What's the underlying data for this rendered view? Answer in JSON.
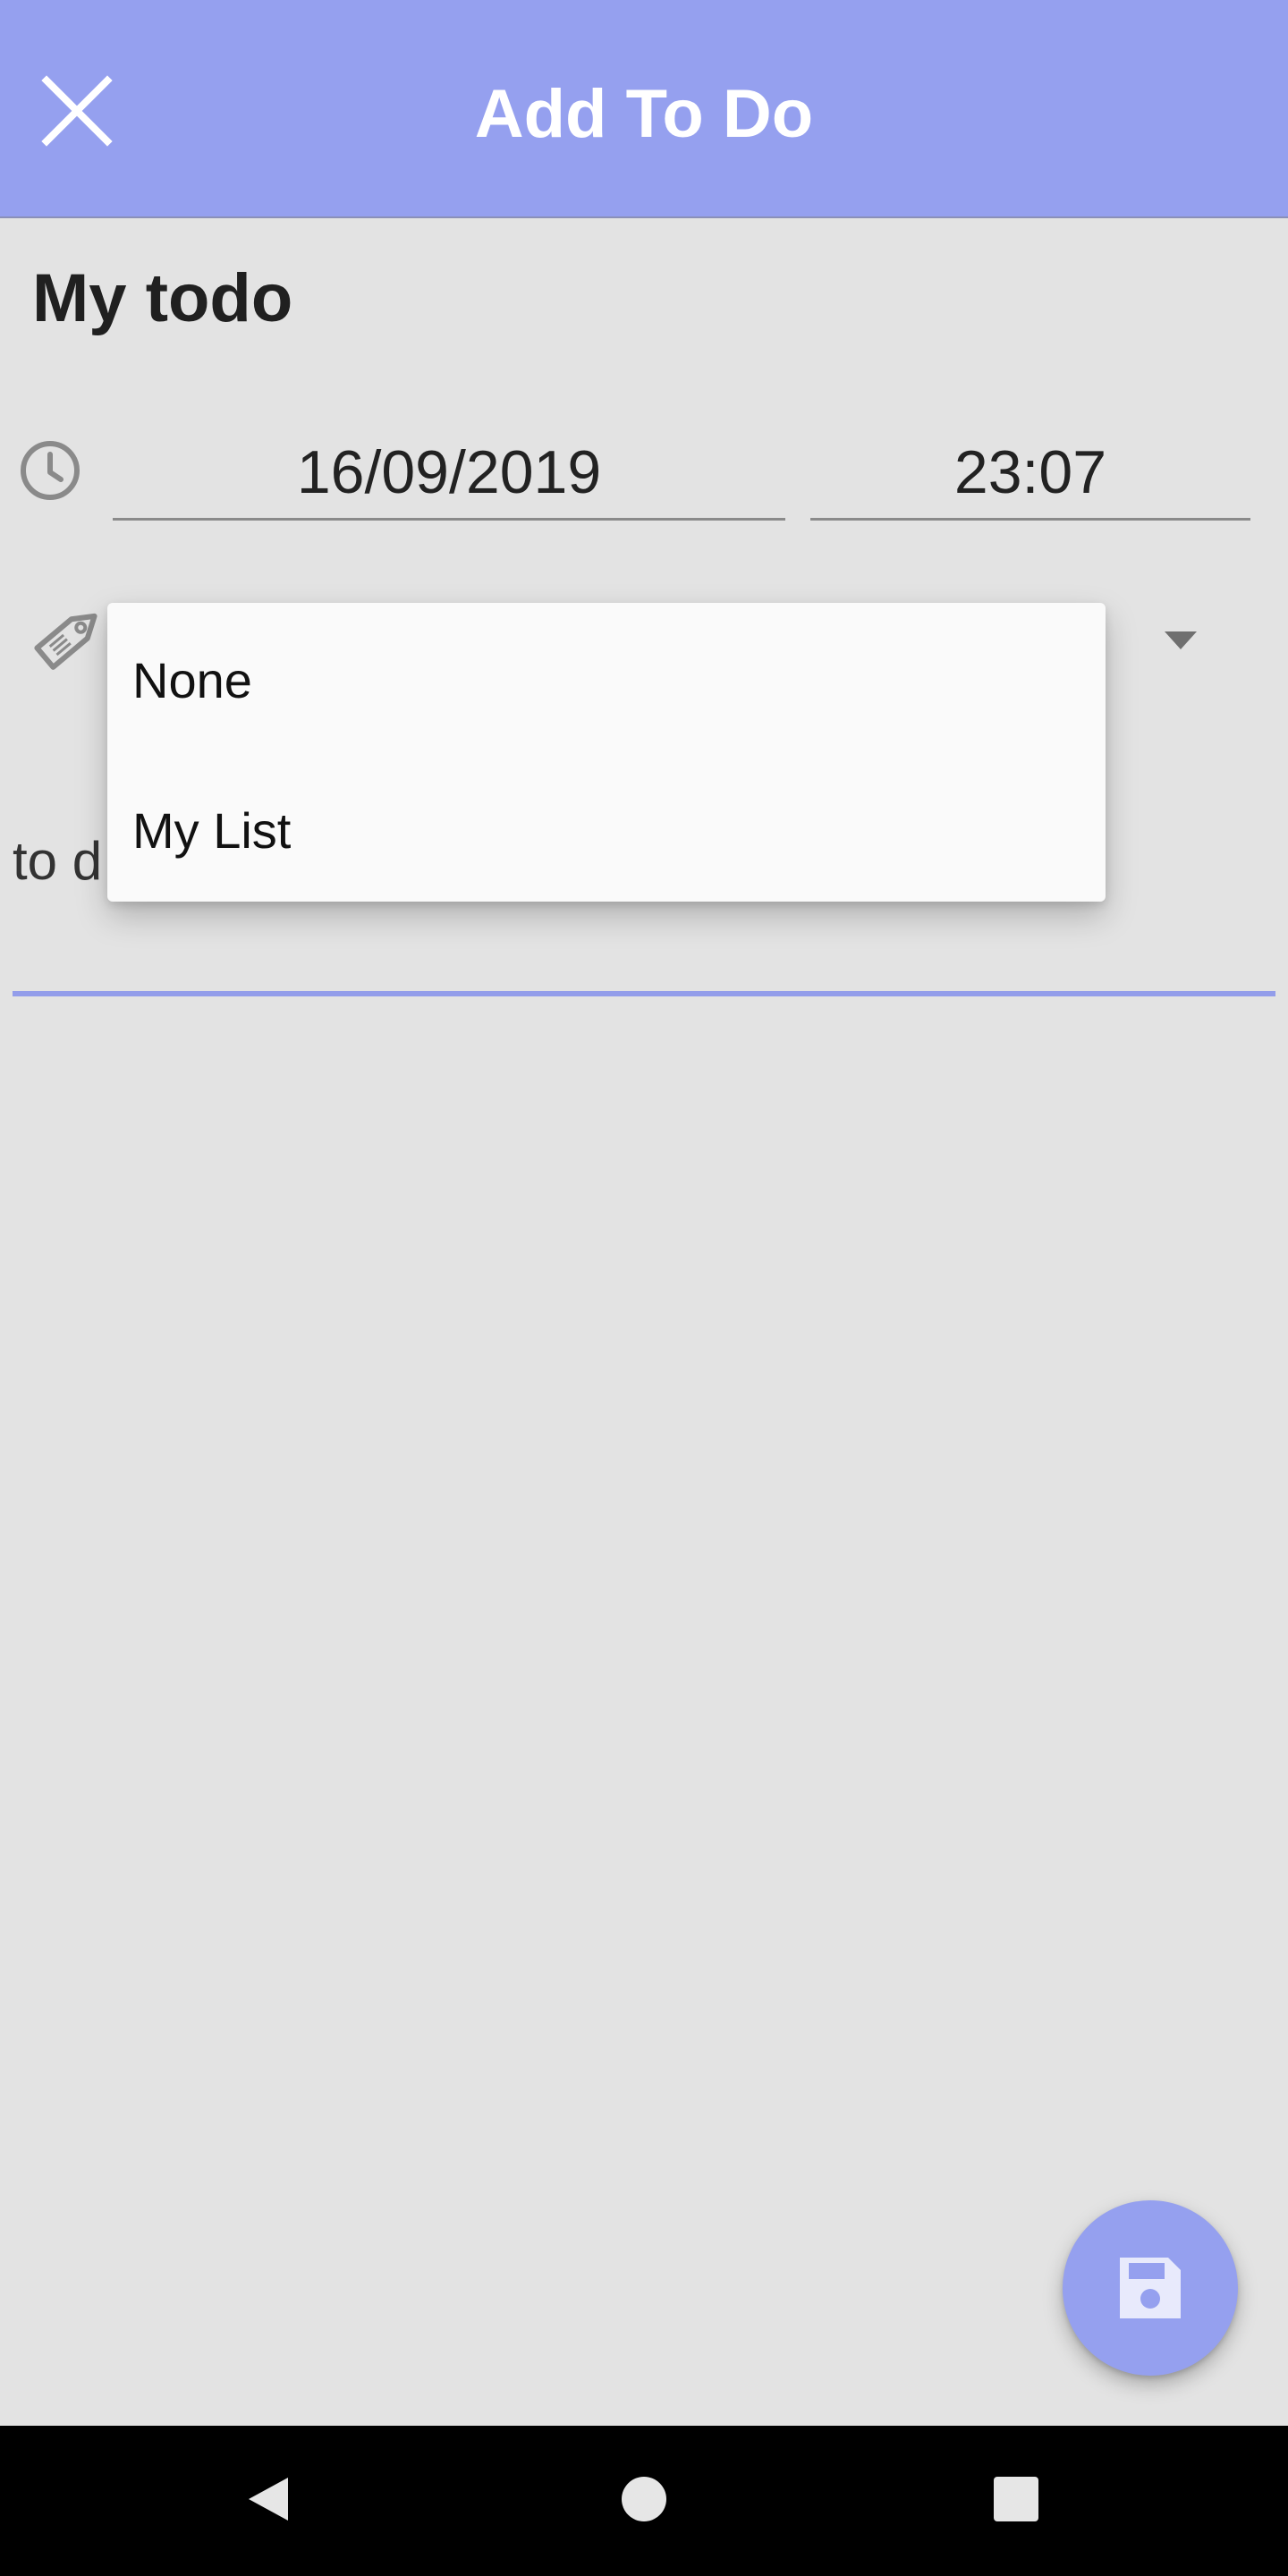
{
  "header": {
    "title": "Add To Do",
    "close_icon": "close-icon"
  },
  "todo": {
    "title": "My todo"
  },
  "datetime": {
    "date": "16/09/2019",
    "time": "23:07"
  },
  "category": {
    "options": [
      "None",
      "My List"
    ]
  },
  "description": {
    "partial_text": "to d"
  },
  "fab": {
    "icon": "save-icon"
  },
  "colors": {
    "accent": "#95a0ef",
    "background": "#e3e3e3"
  }
}
